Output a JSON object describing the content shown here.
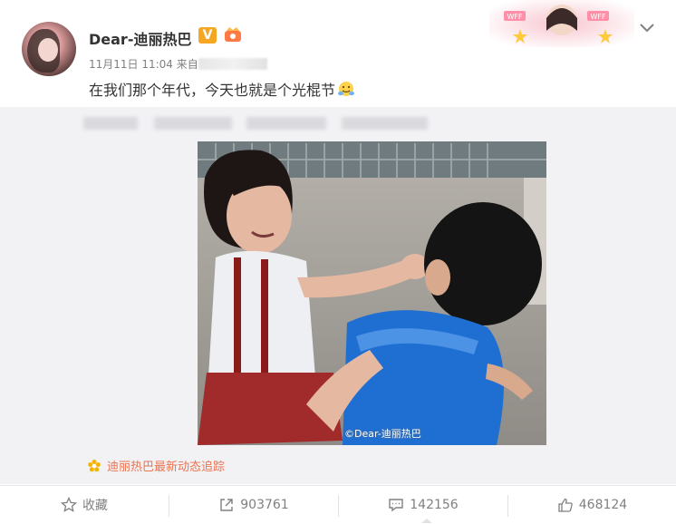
{
  "post": {
    "username": "Dear-迪丽热巴",
    "verified_badge": "V",
    "time_label": "11月11日 11:04",
    "source_prefix": "来自",
    "text": "在我们那个年代，今天也就是个光棍节",
    "emoji_icon": "hug-emoji-icon"
  },
  "banner": {
    "badge_text": "WFF"
  },
  "media": {
    "watermark": "©Dear-迪丽热巴"
  },
  "tracker": {
    "label": "迪丽热巴最新动态追踪"
  },
  "actions": {
    "favorite": "收藏",
    "reposts": "903761",
    "comments": "142156",
    "likes": "468124"
  },
  "colors": {
    "accent": "#eb7350",
    "verified": "#f5a623",
    "muted": "#808080",
    "repost_bg": "#f2f2f5"
  }
}
